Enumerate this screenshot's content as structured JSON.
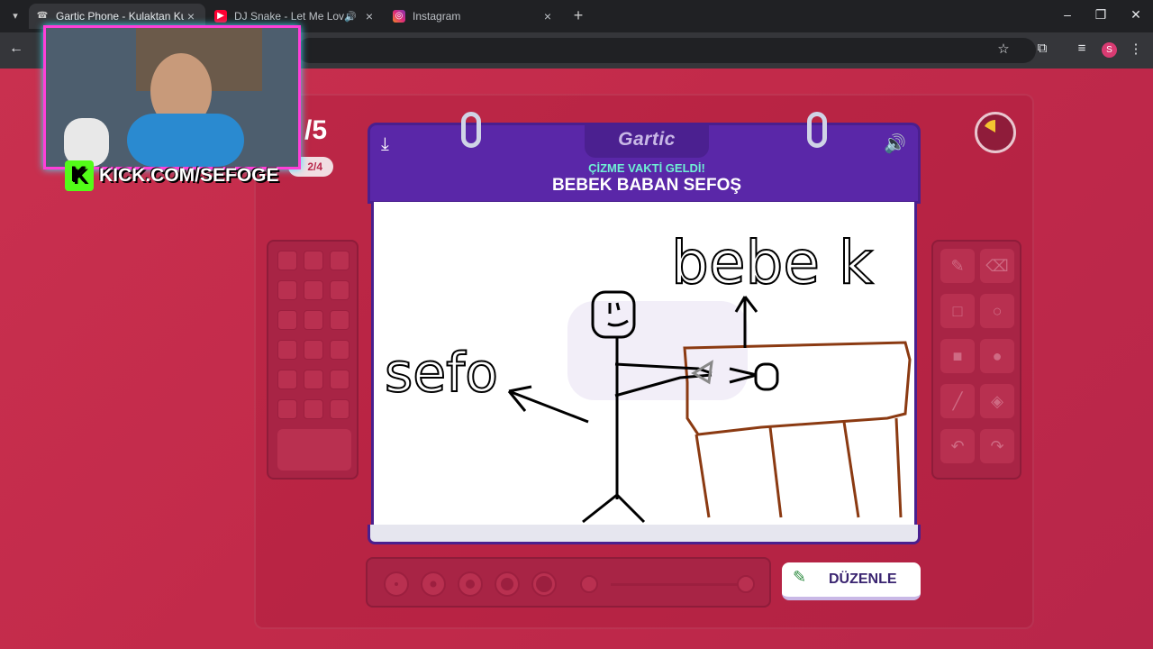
{
  "browser": {
    "tabs": [
      {
        "title": "Gartic Phone - Kulaktan Kulağa",
        "active": true,
        "favicon": "phone-icon",
        "audio": false
      },
      {
        "title": "DJ Snake - Let Me Love You",
        "active": false,
        "favicon": "youtube-icon",
        "audio": true
      },
      {
        "title": "Instagram",
        "active": false,
        "favicon": "instagram-icon",
        "audio": false
      }
    ],
    "profile_initial": "S"
  },
  "stream_overlay": {
    "kick_label": "KICK.COM/SEFOGE"
  },
  "game": {
    "logo": "Gartic",
    "subtitle": "ÇİZME VAKTİ GELDİ!",
    "word": "BEBEK BABAN SEFOŞ",
    "score_partial": "/5",
    "round_partial": "2/4",
    "edit_button": "DÜZENLE",
    "drawing_texts": {
      "left": "sefo",
      "top_right": "bebe k"
    }
  },
  "colors": {
    "background": "#c22a4a",
    "board_header": "#5a27a8",
    "subtitle": "#6ff0d4",
    "kick_green": "#53fc18",
    "stroke_black": "#000000",
    "stroke_brown": "#8b4513"
  }
}
